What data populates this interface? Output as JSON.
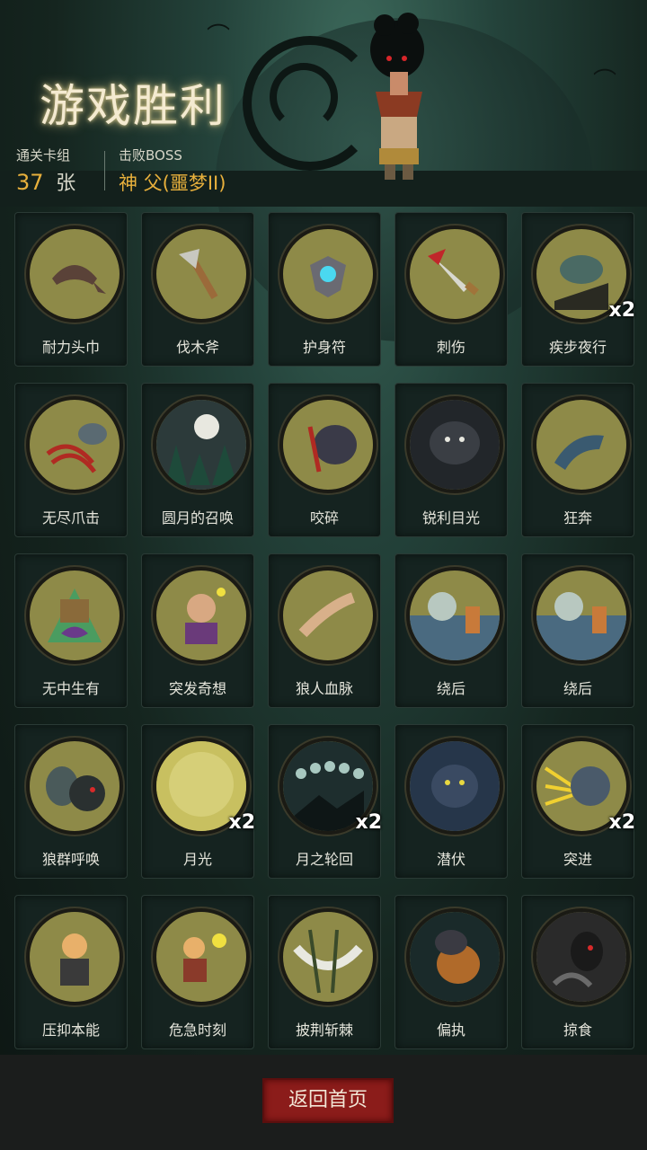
{
  "title": "游戏胜利",
  "stats": {
    "deck_label": "通关卡组",
    "deck_count": "37",
    "deck_unit": "张",
    "boss_label": "击败BOSS",
    "boss_name": "神 父(噩梦II)"
  },
  "cards": [
    {
      "name": "耐力头巾",
      "icon": "bandana-icon",
      "badge": ""
    },
    {
      "name": "伐木斧",
      "icon": "axe-icon",
      "badge": ""
    },
    {
      "name": "护身符",
      "icon": "amulet-icon",
      "badge": ""
    },
    {
      "name": "刺伤",
      "icon": "dagger-icon",
      "badge": ""
    },
    {
      "name": "疾步夜行",
      "icon": "werewolf-run-icon",
      "badge": "x2"
    },
    {
      "name": "无尽爪击",
      "icon": "claw-icon",
      "badge": ""
    },
    {
      "name": "圆月的召唤",
      "icon": "full-moon-forest-icon",
      "badge": ""
    },
    {
      "name": "咬碎",
      "icon": "bite-icon",
      "badge": ""
    },
    {
      "name": "锐利目光",
      "icon": "wolf-eyes-icon",
      "badge": ""
    },
    {
      "name": "狂奔",
      "icon": "wolf-dash-icon",
      "badge": ""
    },
    {
      "name": "无中生有",
      "icon": "summon-icon",
      "badge": ""
    },
    {
      "name": "突发奇想",
      "icon": "idea-icon",
      "badge": ""
    },
    {
      "name": "狼人血脉",
      "icon": "bloodline-icon",
      "badge": ""
    },
    {
      "name": "绕后",
      "icon": "flank-icon",
      "badge": ""
    },
    {
      "name": "绕后",
      "icon": "flank-icon",
      "badge": ""
    },
    {
      "name": "狼群呼唤",
      "icon": "wolf-pack-icon",
      "badge": ""
    },
    {
      "name": "月光",
      "icon": "moonlight-icon",
      "badge": "x2"
    },
    {
      "name": "月之轮回",
      "icon": "moon-phases-icon",
      "badge": "x2"
    },
    {
      "name": "潜伏",
      "icon": "lurk-icon",
      "badge": ""
    },
    {
      "name": "突进",
      "icon": "charge-icon",
      "badge": "x2"
    },
    {
      "name": "压抑本能",
      "icon": "suppress-icon",
      "badge": ""
    },
    {
      "name": "危急时刻",
      "icon": "crisis-icon",
      "badge": ""
    },
    {
      "name": "披荆斩棘",
      "icon": "thorn-slash-icon",
      "badge": ""
    },
    {
      "name": "偏执",
      "icon": "paranoia-icon",
      "badge": ""
    },
    {
      "name": "掠食",
      "icon": "predation-icon",
      "badge": ""
    }
  ],
  "footer": {
    "return_label": "返回首页"
  },
  "colors": {
    "accent": "#e8b03c",
    "button": "#8b1c1a",
    "coin": "#8e8a48"
  }
}
